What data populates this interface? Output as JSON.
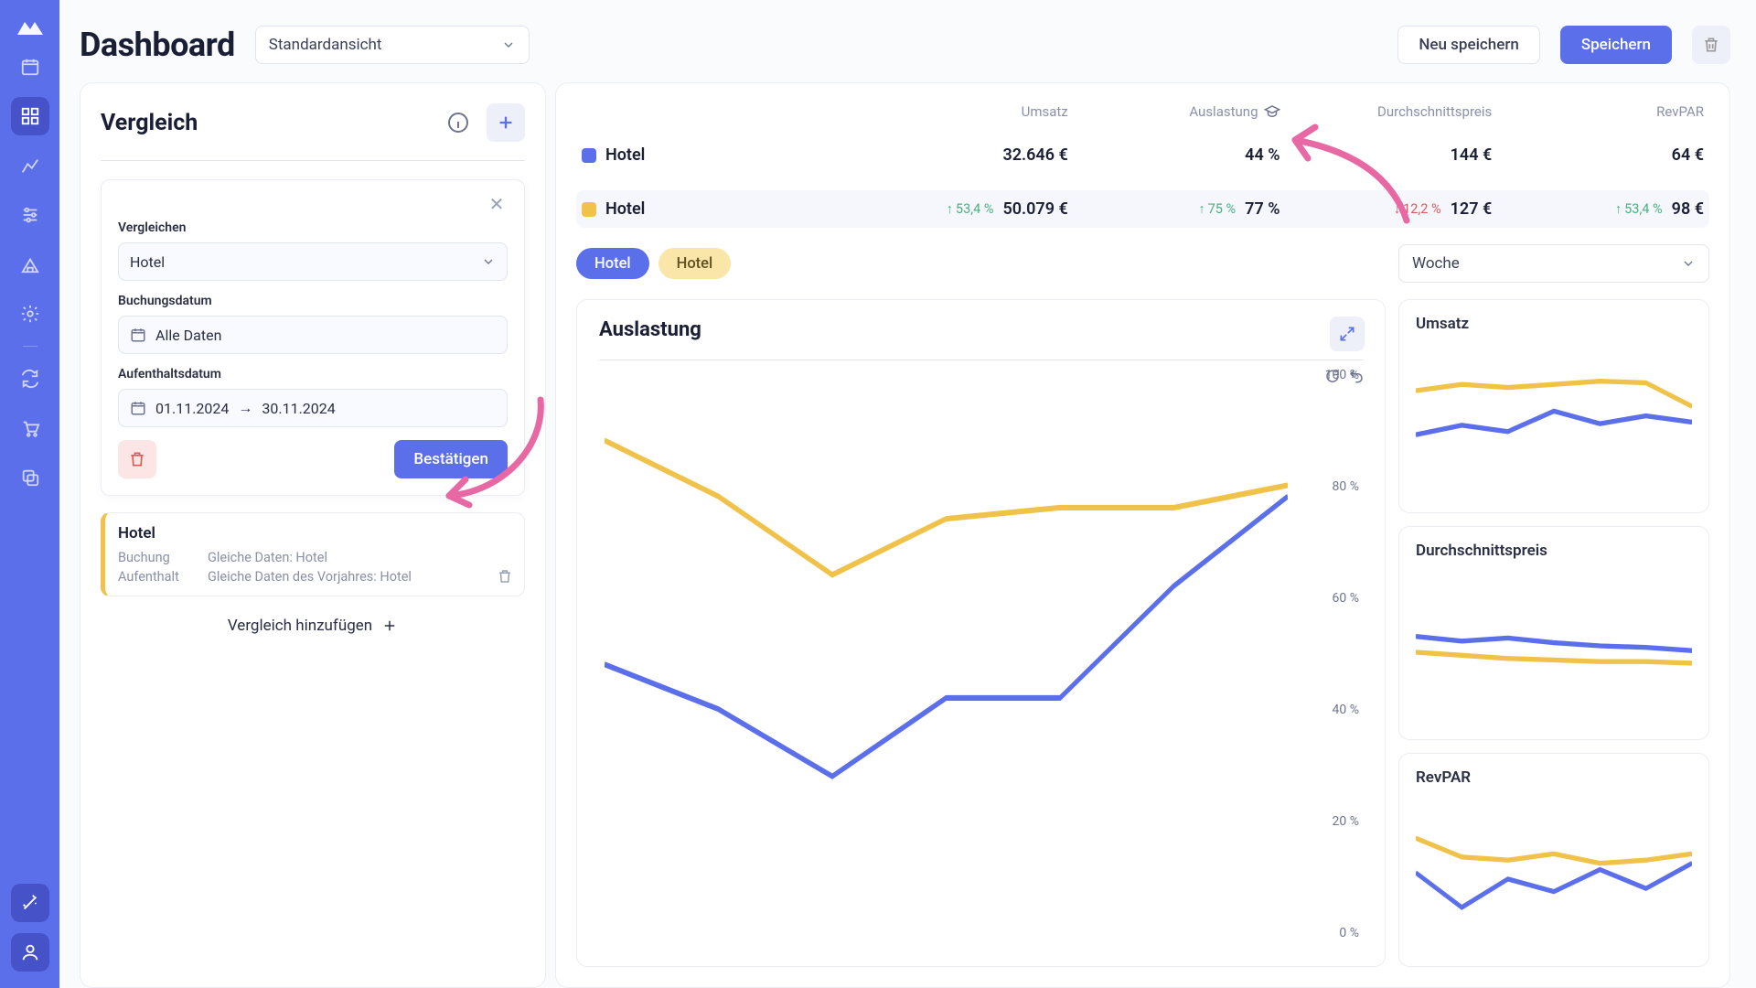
{
  "colors": {
    "brand": "#5b6feb",
    "yellow": "#f1c24a",
    "green": "#49b07d",
    "red": "#dc5a5a",
    "pink": "#e768a3"
  },
  "header": {
    "title": "Dashboard",
    "view_label": "Standardansicht",
    "save_new": "Neu speichern",
    "save": "Speichern"
  },
  "compare": {
    "heading": "Vergleich",
    "edit": {
      "compare_label": "Vergleichen",
      "compare_value": "Hotel",
      "booking_label": "Buchungsdatum",
      "booking_value": "Alle Daten",
      "stay_label": "Aufenthaltsdatum",
      "stay_from": "01.11.2024",
      "stay_to": "30.11.2024",
      "date_sep": "→",
      "confirm": "Bestätigen"
    },
    "saved": {
      "name": "Hotel",
      "booking_k": "Buchung",
      "booking_v": "Gleiche Daten: Hotel",
      "stay_k": "Aufenthalt",
      "stay_v": "Gleiche Daten des Vorjahres: Hotel"
    },
    "add": "Vergleich hinzufügen"
  },
  "metrics": {
    "cols": [
      "Umsatz",
      "Auslastung",
      "Durchschnittspreis",
      "RevPAR"
    ],
    "rows": [
      {
        "swatch": "blue",
        "name": "Hotel",
        "umsatz": "32.646 €",
        "auslastung": "44 %",
        "preis": "144 €",
        "revpar": "64 €"
      },
      {
        "swatch": "yellow",
        "name": "Hotel",
        "umsatz": "50.079 €",
        "umsatz_d": "53,4 %",
        "auslastung": "77 %",
        "auslastung_d": "75 %",
        "preis": "127 €",
        "preis_d": "12,2 %",
        "preis_neg": true,
        "revpar": "98 €",
        "revpar_d": "53,4 %"
      }
    ]
  },
  "pills": {
    "blue": "Hotel",
    "yellow": "Hotel",
    "range": "Woche"
  },
  "chart": {
    "title": "Auslastung",
    "yticks": [
      "100 %",
      "80 %",
      "60 %",
      "40 %",
      "20 %",
      "0 %"
    ]
  },
  "mini": {
    "a": "Umsatz",
    "b": "Durchschnittspreis",
    "c": "RevPAR"
  },
  "chart_data": {
    "type": "line",
    "title": "Auslastung",
    "ylabel": "",
    "ylim": [
      0,
      100
    ],
    "x_index": [
      0,
      1,
      2,
      3,
      4,
      5,
      6
    ],
    "series": [
      {
        "name": "Hotel (blue)",
        "color": "#5b6feb",
        "values": [
          48,
          40,
          28,
          42,
          42,
          62,
          78
        ]
      },
      {
        "name": "Hotel (yellow)",
        "color": "#f1c24a",
        "values": [
          88,
          78,
          64,
          74,
          76,
          76,
          80
        ]
      }
    ],
    "mini": [
      {
        "title": "Umsatz",
        "series": [
          {
            "name": "blue",
            "values": [
              40,
              46,
              42,
              55,
              47,
              52,
              48
            ]
          },
          {
            "name": "yellow",
            "values": [
              68,
              72,
              70,
              72,
              74,
              73,
              58
            ]
          }
        ]
      },
      {
        "title": "Durchschnittspreis",
        "series": [
          {
            "name": "blue",
            "values": [
              56,
              53,
              55,
              52,
              50,
              49,
              47
            ]
          },
          {
            "name": "yellow",
            "values": [
              46,
              44,
              42,
              41,
              40,
              40,
              39
            ]
          }
        ]
      },
      {
        "title": "RevPAR",
        "series": [
          {
            "name": "blue",
            "values": [
              50,
              28,
              46,
              38,
              52,
              40,
              56
            ]
          },
          {
            "name": "yellow",
            "values": [
              72,
              60,
              58,
              62,
              56,
              58,
              62
            ]
          }
        ]
      }
    ]
  }
}
